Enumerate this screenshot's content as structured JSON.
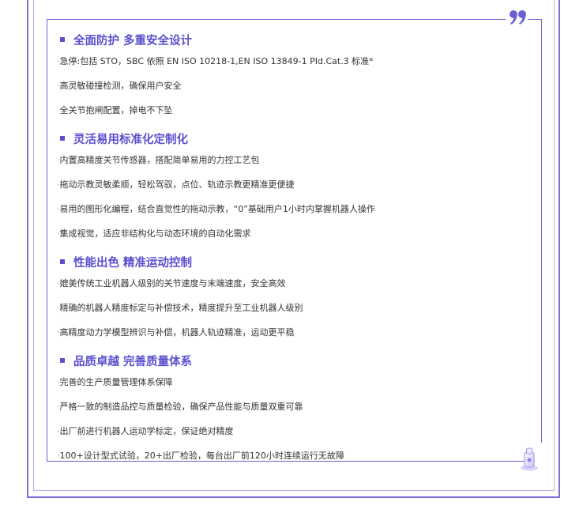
{
  "sections": [
    {
      "title": "全面防护 多重安全设计",
      "items": [
        "急停:包括 STO，SBC 依照 EN ISO 10218-1,EN ISO 13849-1 PId.Cat.3 标准*",
        "高灵敏碰撞检测，确保用户安全",
        "全关节抱闸配置，掉电不下坠"
      ]
    },
    {
      "title": "灵活易用标准化定制化",
      "items": [
        "内置高精度关节传感器，搭配简单易用的力控工艺包",
        "拖动示教灵敏柔顺，轻松驾驭，点位、轨迹示教更精准更便捷",
        "易用的图形化编程，结合直觉性的拖动示教，“0”基础用户1小时内掌握机器人操作",
        "集成视觉，适应非结构化与动态环境的自动化需求"
      ]
    },
    {
      "title": "性能出色 精准运动控制",
      "items": [
        "媲美传统工业机器人级别的关节速度与末端速度，安全高效",
        "精确的机器人精度标定与补偿技术，精度提升至工业机器人级别",
        "高精度动力学模型辨识与补偿，机器人轨迹精准，运动更平稳"
      ]
    },
    {
      "title": "品质卓越 完善质量体系",
      "items": [
        "完善的生产质量管理体系保障",
        "严格一致的制造品控与质量检验，确保产品性能与质量双重可靠",
        "出厂前进行机器人运动学标定，保证绝对精度",
        "100+设计型式试验，20+出厂检验，每台出厂前120小时连续运行无故障"
      ]
    }
  ],
  "colors": {
    "accent": "#5b4fd0",
    "frame": "#6c5fd4",
    "text": "#333333"
  }
}
